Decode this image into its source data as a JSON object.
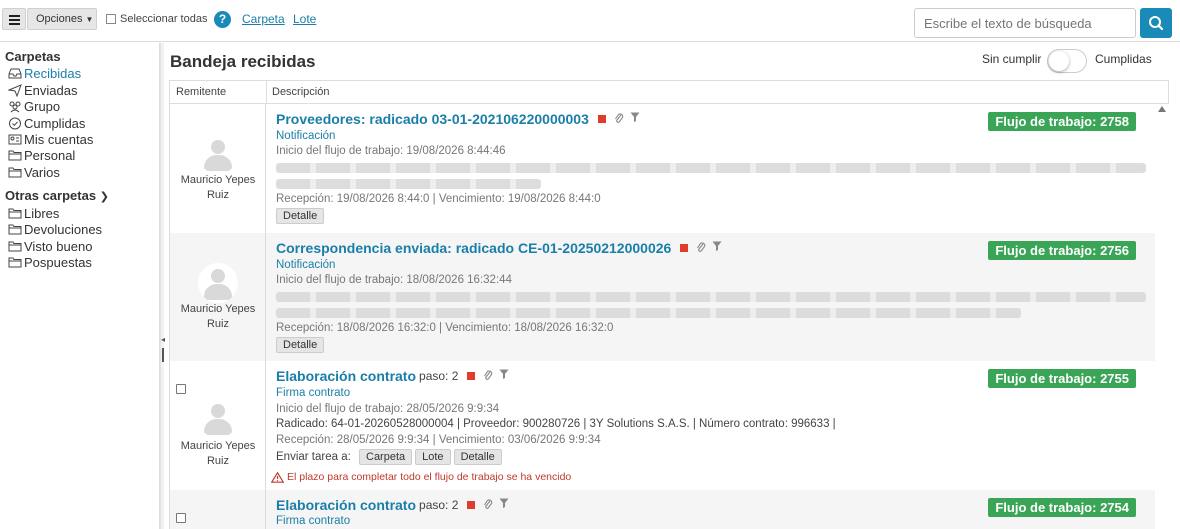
{
  "toolbar": {
    "options_label": "Opciones",
    "select_all_label": "Seleccionar todas",
    "help_icon": "question-circle-icon",
    "links": [
      "Carpeta",
      "Lote"
    ],
    "search_placeholder": "Escribe el texto de búsqueda",
    "search_icon": "search-icon"
  },
  "sidebar": {
    "folders_title": "Carpetas",
    "folders": [
      {
        "label": "Recibidas",
        "icon": "inbox-icon",
        "active": true
      },
      {
        "label": "Enviadas",
        "icon": "send-icon",
        "active": false
      },
      {
        "label": "Grupo",
        "icon": "group-icon",
        "active": false
      },
      {
        "label": "Cumplidas",
        "icon": "check-circle-icon",
        "active": false
      },
      {
        "label": "Mis cuentas",
        "icon": "id-card-icon",
        "active": false
      },
      {
        "label": "Personal",
        "icon": "folder-icon",
        "active": false
      },
      {
        "label": "Varios",
        "icon": "folder-icon",
        "active": false
      }
    ],
    "other_title": "Otras carpetas",
    "other_folders": [
      {
        "label": "Libres",
        "icon": "folder-icon"
      },
      {
        "label": "Devoluciones",
        "icon": "folder-icon"
      },
      {
        "label": "Visto bueno",
        "icon": "folder-icon"
      },
      {
        "label": "Pospuestas",
        "icon": "folder-icon"
      }
    ]
  },
  "main": {
    "title": "Bandeja recibidas",
    "toggle_left": "Sin cumplir",
    "toggle_right": "Cumplidas",
    "toggle_on": false,
    "col_sender": "Remitente",
    "col_description": "Descripción"
  },
  "rows": [
    {
      "sender_line1": "Mauricio Yepes",
      "sender_line2": "Ruiz",
      "title": "Proveedores: radicado 03-01-202106220000003",
      "paso": "",
      "subtitle": "Notificación",
      "start": "Inicio del flujo de trabajo: 19/08/2026 8:44:46",
      "reception": "Recepción: 19/08/2026 8:44:0 | Vencimiento: 19/08/2026 8:44:0",
      "badge": "Flujo de trabajo: 2758",
      "detail_label": "Detalle"
    },
    {
      "sender_line1": "Mauricio Yepes",
      "sender_line2": "Ruiz",
      "title": "Correspondencia enviada: radicado CE-01-20250212000026",
      "paso": "",
      "subtitle": "Notificación",
      "start": "Inicio del flujo de trabajo: 18/08/2026 16:32:44",
      "reception": "Recepción: 18/08/2026 16:32:0 | Vencimiento: 18/08/2026 16:32:0",
      "badge": "Flujo de trabajo: 2756",
      "detail_label": "Detalle"
    },
    {
      "sender_line1": "Mauricio Yepes",
      "sender_line2": "Ruiz",
      "title": "Elaboración contrato",
      "paso": "paso: 2",
      "subtitle": "Firma contrato",
      "start": "Inicio del flujo de trabajo: 28/05/2026 9:9:34",
      "radicado": "Radicado: 64-01-20260528000004 | Proveedor: 900280726 | 3Y Solutions S.A.S. | Número contrato: 996633 |",
      "reception": "Recepción: 28/05/2026 9:9:34 | Vencimiento: 03/06/2026 9:9:34",
      "send_task_label": "Enviar tarea a:",
      "chips": [
        "Carpeta",
        "Lote",
        "Detalle"
      ],
      "warning": "El plazo para completar todo el flujo de trabajo se ha vencido",
      "badge": "Flujo de trabajo: 2755"
    },
    {
      "title": "Elaboración contrato",
      "paso": "paso: 2",
      "subtitle": "Firma contrato",
      "badge": "Flujo de trabajo: 2754"
    }
  ]
}
